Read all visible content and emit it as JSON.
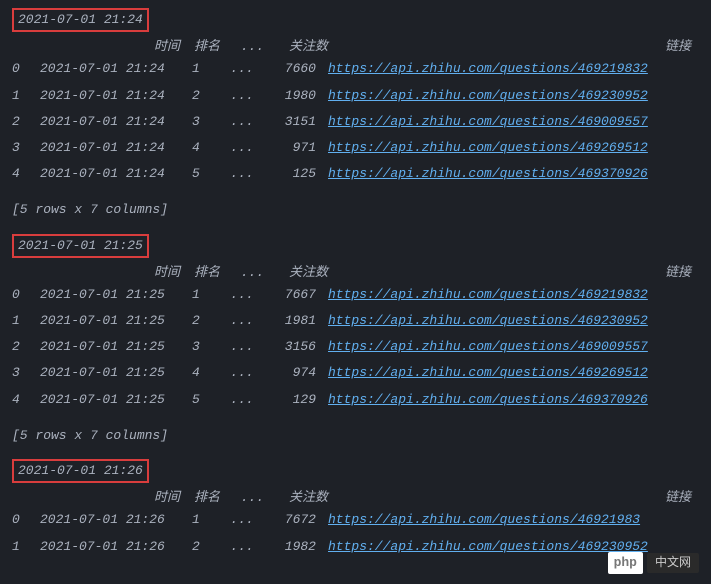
{
  "blocks": [
    {
      "timestamp": "2021-07-01 21:24",
      "headers": {
        "time": "时间",
        "rank": "排名",
        "ellipsis": "...",
        "follow": "关注数",
        "link": "链接"
      },
      "rows": [
        {
          "idx": "0",
          "time": "2021-07-01 21:24",
          "rank": "1",
          "ellipsis": "...",
          "follow": "7660",
          "url": "https://api.zhihu.com/questions/469219832"
        },
        {
          "idx": "1",
          "time": "2021-07-01 21:24",
          "rank": "2",
          "ellipsis": "...",
          "follow": "1980",
          "url": "https://api.zhihu.com/questions/469230952"
        },
        {
          "idx": "2",
          "time": "2021-07-01 21:24",
          "rank": "3",
          "ellipsis": "...",
          "follow": "3151",
          "url": "https://api.zhihu.com/questions/469009557"
        },
        {
          "idx": "3",
          "time": "2021-07-01 21:24",
          "rank": "4",
          "ellipsis": "...",
          "follow": "971",
          "url": "https://api.zhihu.com/questions/469269512"
        },
        {
          "idx": "4",
          "time": "2021-07-01 21:24",
          "rank": "5",
          "ellipsis": "...",
          "follow": "125",
          "url": "https://api.zhihu.com/questions/469370926"
        }
      ],
      "summary": "[5 rows x 7 columns]"
    },
    {
      "timestamp": "2021-07-01 21:25",
      "headers": {
        "time": "时间",
        "rank": "排名",
        "ellipsis": "...",
        "follow": "关注数",
        "link": "链接"
      },
      "rows": [
        {
          "idx": "0",
          "time": "2021-07-01 21:25",
          "rank": "1",
          "ellipsis": "...",
          "follow": "7667",
          "url": "https://api.zhihu.com/questions/469219832"
        },
        {
          "idx": "1",
          "time": "2021-07-01 21:25",
          "rank": "2",
          "ellipsis": "...",
          "follow": "1981",
          "url": "https://api.zhihu.com/questions/469230952"
        },
        {
          "idx": "2",
          "time": "2021-07-01 21:25",
          "rank": "3",
          "ellipsis": "...",
          "follow": "3156",
          "url": "https://api.zhihu.com/questions/469009557"
        },
        {
          "idx": "3",
          "time": "2021-07-01 21:25",
          "rank": "4",
          "ellipsis": "...",
          "follow": "974",
          "url": "https://api.zhihu.com/questions/469269512"
        },
        {
          "idx": "4",
          "time": "2021-07-01 21:25",
          "rank": "5",
          "ellipsis": "...",
          "follow": "129",
          "url": "https://api.zhihu.com/questions/469370926"
        }
      ],
      "summary": "[5 rows x 7 columns]"
    },
    {
      "timestamp": "2021-07-01 21:26",
      "headers": {
        "time": "时间",
        "rank": "排名",
        "ellipsis": "...",
        "follow": "关注数",
        "link": "链接"
      },
      "rows": [
        {
          "idx": "0",
          "time": "2021-07-01 21:26",
          "rank": "1",
          "ellipsis": "...",
          "follow": "7672",
          "url": "https://api.zhihu.com/questions/46921983"
        },
        {
          "idx": "1",
          "time": "2021-07-01 21:26",
          "rank": "2",
          "ellipsis": "...",
          "follow": "1982",
          "url": "https://api.zhihu.com/questions/469230952"
        }
      ],
      "summary": ""
    }
  ],
  "watermark": {
    "badge": "php",
    "text": "中文网"
  }
}
